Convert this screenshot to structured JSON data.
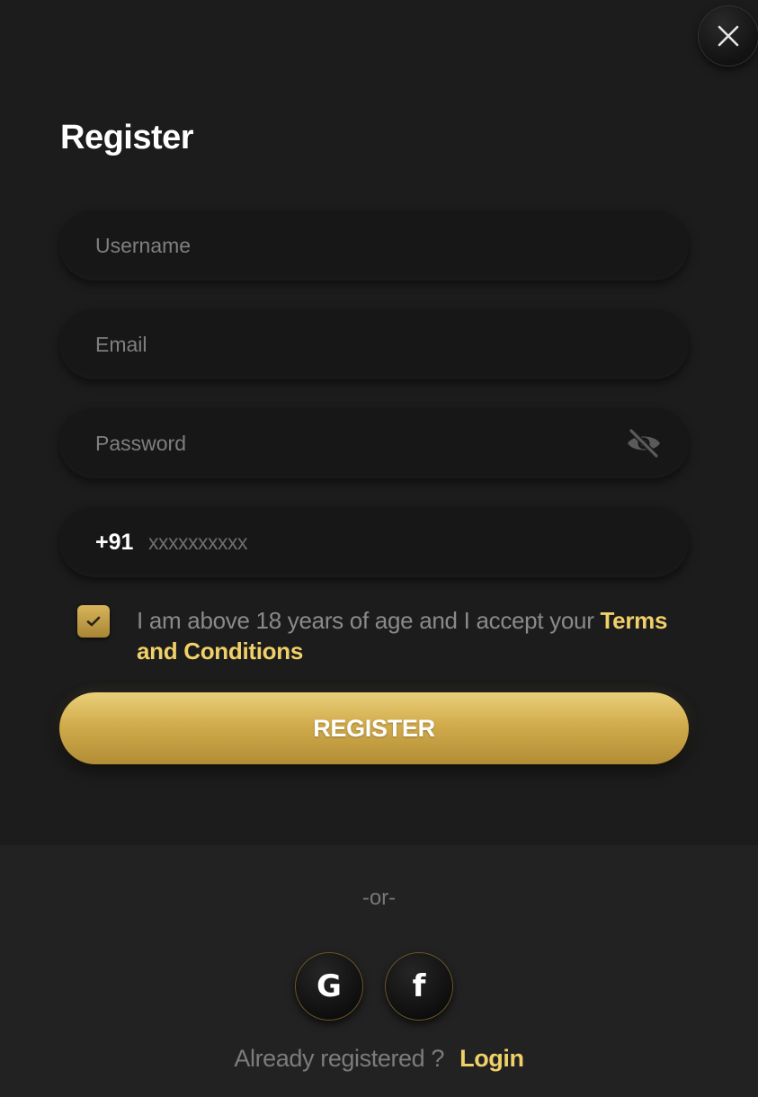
{
  "modal": {
    "title": "Register"
  },
  "form": {
    "username_placeholder": "Username",
    "email_placeholder": "Email",
    "password_placeholder": "Password",
    "phone_prefix": "+91",
    "phone_placeholder": "xxxxxxxxxx"
  },
  "terms": {
    "text": "I am above 18 years of age and I accept your",
    "link": "Terms and Conditions",
    "checked": true
  },
  "actions": {
    "register_label": "REGISTER",
    "or_label": "-or-",
    "google_label": "G",
    "facebook_label": "f",
    "already_text": "Already registered ?",
    "login_label": "Login"
  },
  "colors": {
    "accent": "#f0d068",
    "button_gold": "#d1ac4c",
    "background": "#1c1c1c",
    "input_bg": "#171717"
  },
  "icons": {
    "close": "close-icon",
    "password_toggle": "eye-off-icon",
    "checkbox": "check-icon"
  }
}
